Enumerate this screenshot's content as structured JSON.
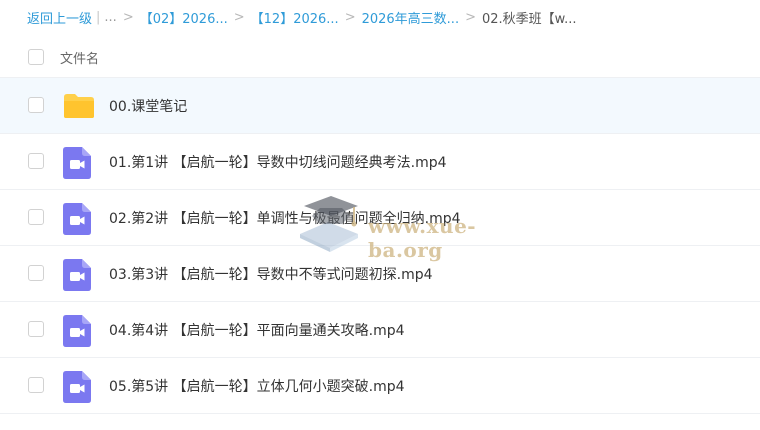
{
  "breadcrumb": {
    "back_label": "返回上一级",
    "ellipsis": "...",
    "items": [
      "【02】2026...",
      "【12】2026...",
      "2026年高三数...",
      "02.秋季班【w..."
    ]
  },
  "table": {
    "header_label": "文件名",
    "files": [
      {
        "name": "00.课堂笔记",
        "type": "folder-icon"
      },
      {
        "name": "01.第1讲 【启航一轮】导数中切线问题经典考法.mp4",
        "type": "video-icon"
      },
      {
        "name": "02.第2讲 【启航一轮】单调性与极最值问题全归纳.mp4",
        "type": "video-icon"
      },
      {
        "name": "03.第3讲 【启航一轮】导数中不等式问题初探.mp4",
        "type": "video-icon"
      },
      {
        "name": "04.第4讲 【启航一轮】平面向量通关攻略.mp4",
        "type": "video-icon"
      },
      {
        "name": "05.第5讲 【启航一轮】立体几何小题突破.mp4",
        "type": "video-icon"
      }
    ]
  },
  "watermark": {
    "text": "www.xue-ba.org"
  },
  "colors": {
    "link": "#2f9bd8",
    "folder": "#ffd04a",
    "video": "#7b78f0",
    "row_selected": "#f3f9fe"
  }
}
